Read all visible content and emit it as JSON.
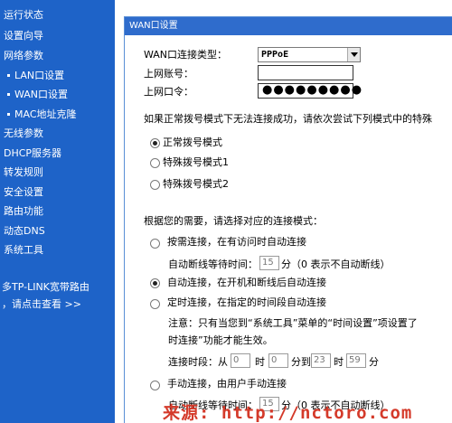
{
  "sidebar": {
    "items": [
      {
        "label": "运行状态",
        "sub": false
      },
      {
        "label": "设置向导",
        "sub": false
      },
      {
        "label": "网络参数",
        "sub": false,
        "active": true
      },
      {
        "label": "LAN口设置",
        "sub": true
      },
      {
        "label": "WAN口设置",
        "sub": true,
        "active": true
      },
      {
        "label": "MAC地址克隆",
        "sub": true
      },
      {
        "label": "无线参数",
        "sub": false
      },
      {
        "label": "DHCP服务器",
        "sub": false
      },
      {
        "label": "转发规则",
        "sub": false
      },
      {
        "label": "安全设置",
        "sub": false
      },
      {
        "label": "路由功能",
        "sub": false
      },
      {
        "label": "动态DNS",
        "sub": false
      },
      {
        "label": "系统工具",
        "sub": false
      }
    ],
    "promo_line1": "多TP-LINK宽带路由",
    "promo_line2": "，请点击查看 >>"
  },
  "panel": {
    "title": "WAN口设置",
    "connection_type_label": "WAN口连接类型：",
    "connection_type_value": "PPPoE",
    "account_label": "上网账号：",
    "account_value": "",
    "password_label": "上网口令：",
    "password_value": "●●●●●●●●●",
    "dial_hint": "如果正常拨号模式下无法连接成功，请依次尝试下列模式中的特殊",
    "dial_modes": [
      {
        "label": "正常拨号模式",
        "checked": true
      },
      {
        "label": "特殊拨号模式1",
        "checked": false
      },
      {
        "label": "特殊拨号模式2",
        "checked": false
      }
    ],
    "connect_hint": "根据您的需要，请选择对应的连接模式：",
    "on_demand_label": "按需连接，在有访问时自动连接",
    "idle_label_1": "自动断线等待时间：",
    "idle_value_1": "15",
    "idle_unit_1": "分（0 表示不自动断线）",
    "auto_label": "自动连接，在开机和断线后自动连接",
    "timed_label": "定时连接，在指定的时间段自动连接",
    "note_line1": "注意：只有当您到“系统工具”菜单的“时间设置”项设置了",
    "note_line2": "时连接”功能才能生效。",
    "period_prefix": "连接时段：从",
    "period_from_h": "0",
    "period_hour_1": "时",
    "period_from_m": "0",
    "period_to_label": "分到",
    "period_to_h": "23",
    "period_hour_2": "时",
    "period_to_m": "59",
    "period_min_end": "分",
    "manual_label": "手动连接，由用户手动连接",
    "idle_label_2": "自动断线等待时间：",
    "idle_value_2": "15",
    "idle_unit_2": "分（0 表示不自动断线）",
    "selected_mode": "auto"
  },
  "watermark": "来源: http://nctoro.com",
  "colors": {
    "sidebar_bg": "#1e63c8",
    "panel_title_bg": "#2f6ccc",
    "watermark": "#d43a2a"
  }
}
